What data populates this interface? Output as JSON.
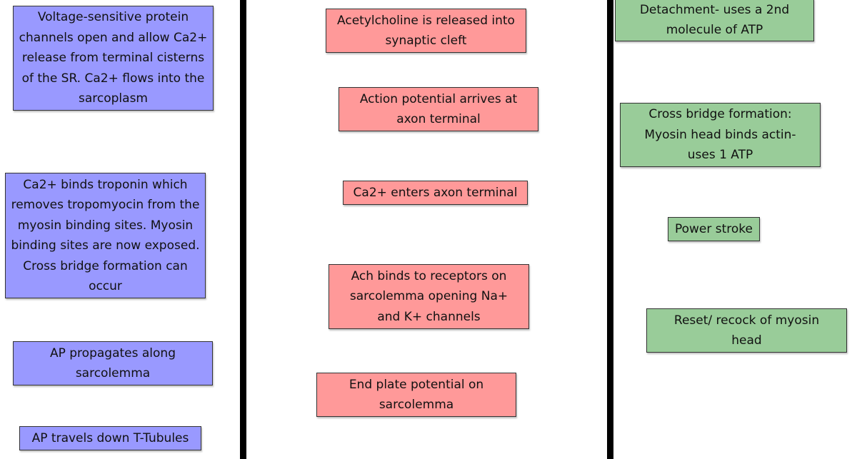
{
  "colors": {
    "blue": "#9999ff",
    "red": "#ff9999",
    "green": "#99cc99",
    "divider": "#000000"
  },
  "left": [
    "Voltage-sensitive protein channels open and allow Ca2+ release from terminal cisterns of the SR. Ca2+ flows into the sarcoplasm",
    "Ca2+ binds troponin which removes tropomyocin from the myosin binding sites. Myosin binding sites are now exposed. Cross bridge formation can occur",
    "AP propagates along sarcolemma",
    "AP travels down T-Tubules"
  ],
  "middle": [
    "Acetylcholine is released into synaptic cleft",
    "Action potential arrives at axon terminal",
    "Ca2+ enters axon terminal",
    "Ach binds to receptors on sarcolemma opening Na+ and K+ channels",
    "End plate potential on sarcolemma"
  ],
  "right": [
    "Detachment- uses a 2nd molecule of ATP",
    "Cross bridge formation: Myosin head binds actin- uses 1 ATP",
    "Power stroke",
    "Reset/ recock of myosin head"
  ]
}
